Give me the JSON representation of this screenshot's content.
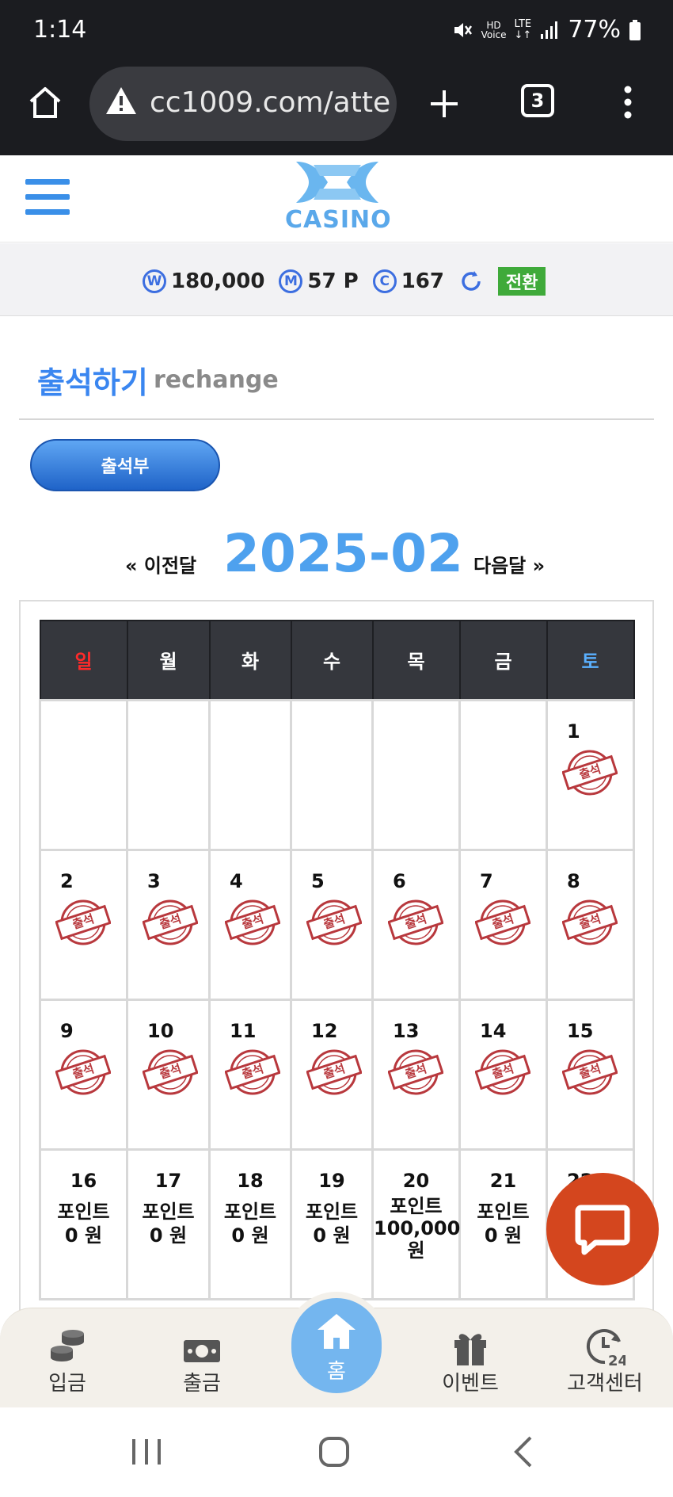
{
  "statusbar": {
    "time": "1:14",
    "battery": "77%",
    "icons": [
      "mute-icon",
      "hd-voice-icon",
      "lte-icon",
      "signal-icon",
      "battery-icon"
    ]
  },
  "browser": {
    "url": "cc1009.com/atte",
    "tab_count": "3"
  },
  "site": {
    "logo_text": "CASINO",
    "colors": {
      "accent": "#3a86f0",
      "logo": "#6ab6ef"
    }
  },
  "balance": {
    "won_icon": "W",
    "won": "180,000",
    "point_icon": "M",
    "point": "57 P",
    "coin_icon": "C",
    "coin": "167",
    "switch_label": "전환"
  },
  "page": {
    "title": "출석하기",
    "subtitle": "rechange",
    "button_label": "출석부"
  },
  "month_nav": {
    "prev": "« 이전달",
    "current": "2025-02",
    "next": "다음달 »"
  },
  "calendar": {
    "weekdays": [
      "일",
      "월",
      "화",
      "수",
      "목",
      "금",
      "토"
    ],
    "weekday_colors": [
      "#ff2a2a",
      "#ffffff",
      "#ffffff",
      "#ffffff",
      "#ffffff",
      "#ffffff",
      "#5ab0ff"
    ],
    "stamp_label": "출석",
    "point_label": "포인트",
    "weeks": [
      [
        {
          "day": ""
        },
        {
          "day": ""
        },
        {
          "day": ""
        },
        {
          "day": ""
        },
        {
          "day": ""
        },
        {
          "day": ""
        },
        {
          "day": "1",
          "stamp": true
        }
      ],
      [
        {
          "day": "2",
          "stamp": true
        },
        {
          "day": "3",
          "stamp": true
        },
        {
          "day": "4",
          "stamp": true
        },
        {
          "day": "5",
          "stamp": true
        },
        {
          "day": "6",
          "stamp": true
        },
        {
          "day": "7",
          "stamp": true
        },
        {
          "day": "8",
          "stamp": true
        }
      ],
      [
        {
          "day": "9",
          "stamp": true
        },
        {
          "day": "10",
          "stamp": true
        },
        {
          "day": "11",
          "stamp": true
        },
        {
          "day": "12",
          "stamp": true
        },
        {
          "day": "13",
          "stamp": true
        },
        {
          "day": "14",
          "stamp": true
        },
        {
          "day": "15",
          "stamp": true
        }
      ],
      [
        {
          "day": "16",
          "points": "0 원"
        },
        {
          "day": "17",
          "points": "0 원"
        },
        {
          "day": "18",
          "points": "0 원"
        },
        {
          "day": "19",
          "points": "0 원"
        },
        {
          "day": "20",
          "points": "100,000 원"
        },
        {
          "day": "21",
          "points": "0 원"
        },
        {
          "day": "22"
        }
      ]
    ]
  },
  "bottom_nav": [
    {
      "label": "입금",
      "icon": "coins-icon"
    },
    {
      "label": "출금",
      "icon": "cash-icon"
    },
    {
      "label": "홈",
      "icon": "home-icon"
    },
    {
      "label": "이벤트",
      "icon": "gift-icon"
    },
    {
      "label": "고객센터",
      "icon": "support-24-icon"
    }
  ]
}
